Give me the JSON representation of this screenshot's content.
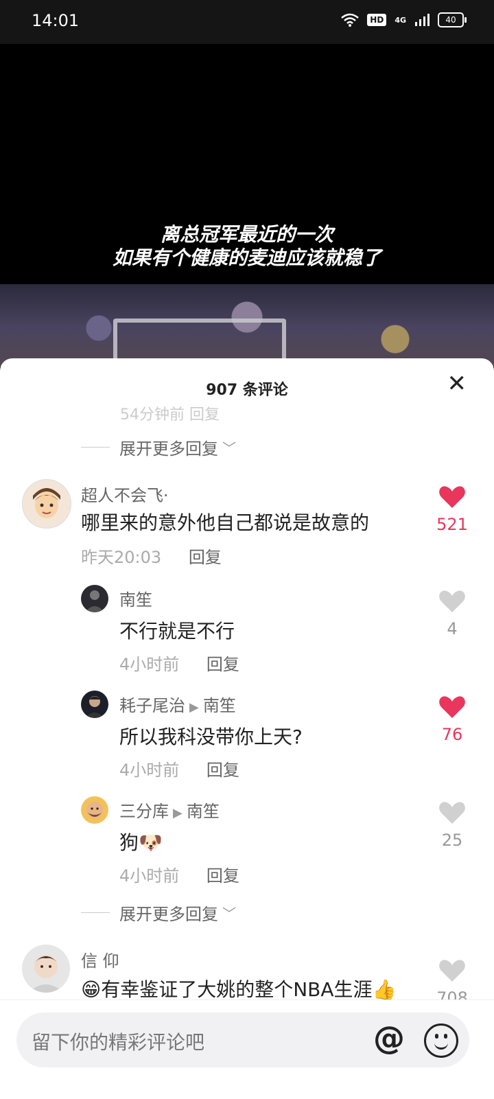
{
  "status_bar": {
    "time": "14:01",
    "hd": "HD",
    "network": "4G",
    "battery": "40"
  },
  "video": {
    "subtitle_line1": "离总冠军最近的一次",
    "subtitle_line2": "如果有个健康的麦迪应该就稳了"
  },
  "sheet": {
    "title": "907 条评论"
  },
  "top_partial": "54分钟前    回复",
  "expand_label": "展开更多回复",
  "comments": [
    {
      "user": "超人不会飞·",
      "text": "哪里来的意外他自己都说是故意的",
      "time": "昨天20:03",
      "reply": "回复",
      "likes": "521",
      "liked": true
    },
    {
      "user": "南笙",
      "text": "不行就是不行",
      "time": "4小时前",
      "reply": "回复",
      "likes": "4",
      "liked": false
    },
    {
      "user": "耗子尾治",
      "reply_to": "南笙",
      "text": "所以我科没带你上天?",
      "time": "4小时前",
      "reply": "回复",
      "likes": "76",
      "liked": true
    },
    {
      "user": "三分库",
      "reply_to": "南笙",
      "text": "狗🐶",
      "time": "4小时前",
      "reply": "回复",
      "likes": "25",
      "liked": false
    },
    {
      "user": "信 仰",
      "text": "😁有幸鉴证了大姚的整个NBA生涯👍",
      "likes": "708",
      "liked": false
    }
  ],
  "input": {
    "placeholder": "留下你的精彩评论吧"
  },
  "colors": {
    "like_active": "#e8365d",
    "like_inactive": "#d0d0d0"
  }
}
